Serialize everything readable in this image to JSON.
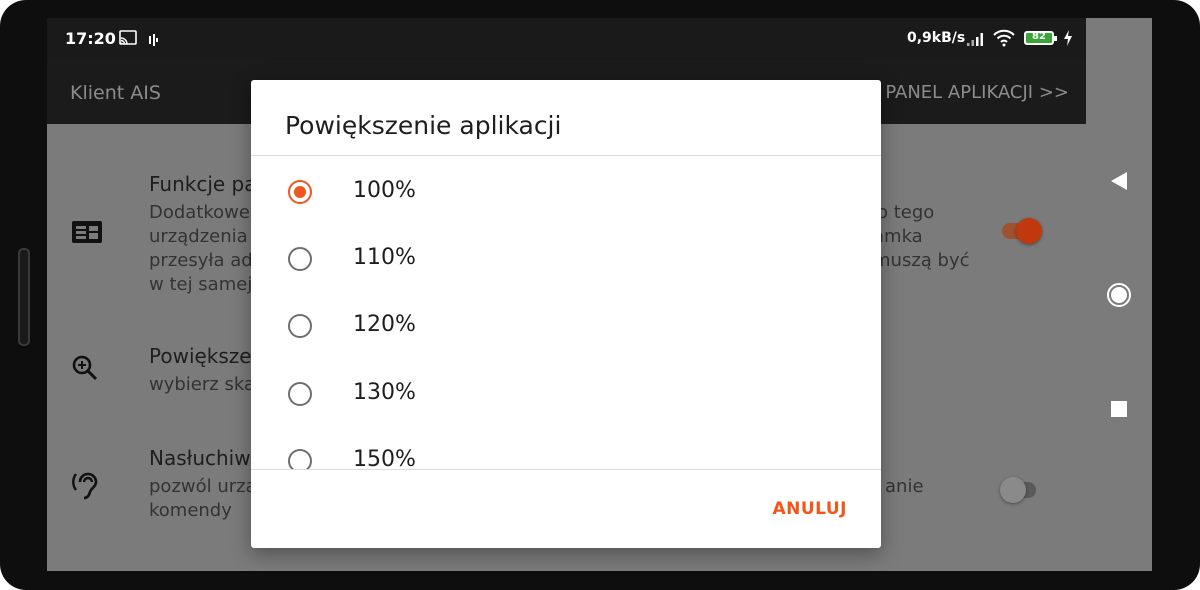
{
  "status_bar": {
    "time": "17:20",
    "network_speed": "0,9kB/s",
    "battery_level": "82",
    "icons": [
      "cast-icon",
      "data-activity-icon",
      "signal-icon",
      "wifi-icon",
      "battery-icon",
      "charging-icon"
    ]
  },
  "app_bar": {
    "title": "Klient AIS",
    "panel_link": "PANEL APLIKACJI >>"
  },
  "settings": [
    {
      "icon": "remote-panel-icon",
      "title": "Funkcje pa",
      "description": [
        "Dodatkowe",
        "urządzenia",
        "przesyła ad",
        "w tej samej"
      ],
      "description_right": [
        "o tego",
        "amka",
        "muszą być"
      ],
      "toggle": true
    },
    {
      "icon": "zoom-in-icon",
      "title": "Powiększe",
      "description": [
        "wybierz ska"
      ]
    },
    {
      "icon": "hearing-icon",
      "title": "Nasłuchiw",
      "description": [
        "pozwól urza",
        "komendy"
      ],
      "description_right": [
        "anie"
      ],
      "toggle": false
    }
  ],
  "nav_bar": [
    "back-icon",
    "home-icon",
    "recents-icon"
  ],
  "dialog": {
    "title": "Powiększenie aplikacji",
    "options": [
      "100%",
      "110%",
      "120%",
      "130%",
      "150%"
    ],
    "selected": "100%",
    "cancel_label": "ANULUJ"
  },
  "colors": {
    "accent": "#f0561d",
    "app_bar": "#1b1b1b",
    "scrim_background": "#7b7b7b",
    "toggle_on": "#c1380f"
  }
}
